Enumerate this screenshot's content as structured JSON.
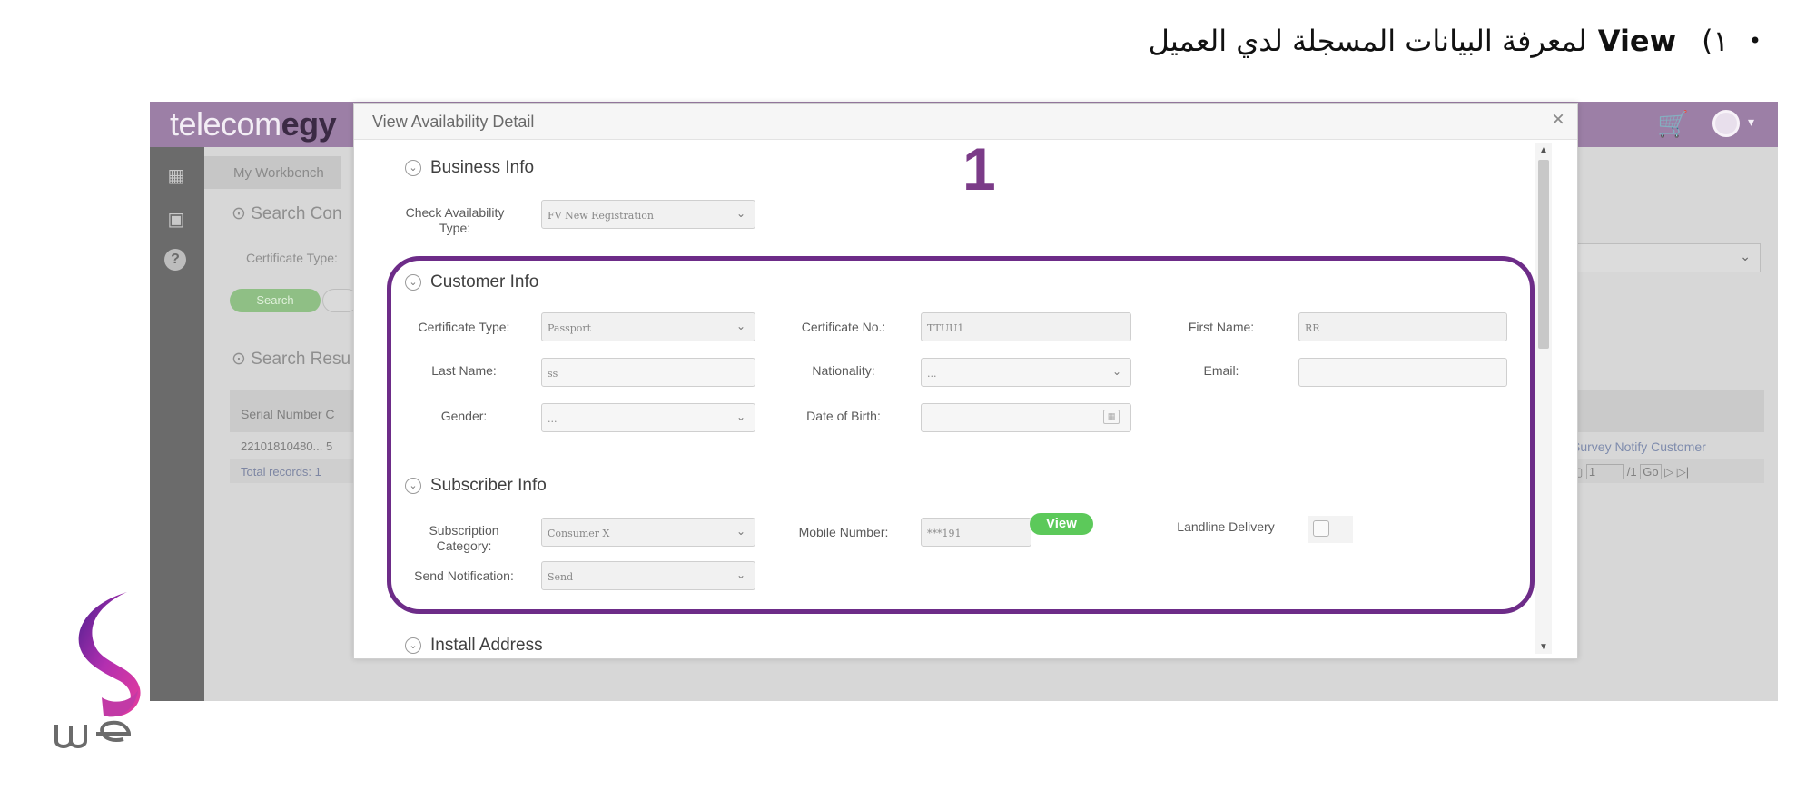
{
  "heading": {
    "bullet": "•",
    "number": "١)",
    "keyword": "View",
    "text": "لمعرفة البيانات المسجلة لدي العميل"
  },
  "app": {
    "brand_light": "telecom",
    "brand_bold": "egy",
    "workbench_tab": "My Workbench",
    "search_conditions": "Search Con",
    "certificate_type_label": "Certificate Type:",
    "search_button": "Search",
    "search_results": "Search Resu",
    "serial_header": "Serial Number",
    "serial_header_cut": "C",
    "serial_value": "22101810480...",
    "serial_value_cut": "5",
    "total_records": "Total records: 1",
    "survey_link": "Survey Notify Customer",
    "pager_page": "1",
    "pager_total": "/1",
    "pager_go": "Go"
  },
  "modal": {
    "title": "View Availability Detail",
    "close": "×",
    "step_number": "1",
    "business_info": {
      "title": "Business Info",
      "check_type_label": "Check Availability Type:",
      "check_type_value": "FV New Registration"
    },
    "customer_info": {
      "title": "Customer Info",
      "certificate_type_label": "Certificate Type:",
      "certificate_type_value": "Passport",
      "certificate_no_label": "Certificate No.:",
      "certificate_no_value": "TTUU1",
      "first_name_label": "First Name:",
      "first_name_value": "RR",
      "last_name_label": "Last Name:",
      "last_name_value": "ss",
      "nationality_label": "Nationality:",
      "nationality_value": "...",
      "email_label": "Email:",
      "email_value": "",
      "gender_label": "Gender:",
      "gender_value": "...",
      "dob_label": "Date of Birth:",
      "dob_value": ""
    },
    "subscriber_info": {
      "title": "Subscriber Info",
      "subscription_category_label": "Subscription Category:",
      "subscription_category_value": "Consumer X",
      "mobile_number_label": "Mobile Number:",
      "mobile_number_value": "***191",
      "view_button": "View",
      "landline_delivery_label": "Landline Delivery",
      "send_notification_label": "Send Notification:",
      "send_notification_value": "Send"
    },
    "install_address": {
      "title": "Install Address"
    }
  },
  "colors": {
    "brand_purple": "#6d2c88",
    "topbar": "#9c7fa6",
    "view_green": "#5cc95a"
  }
}
